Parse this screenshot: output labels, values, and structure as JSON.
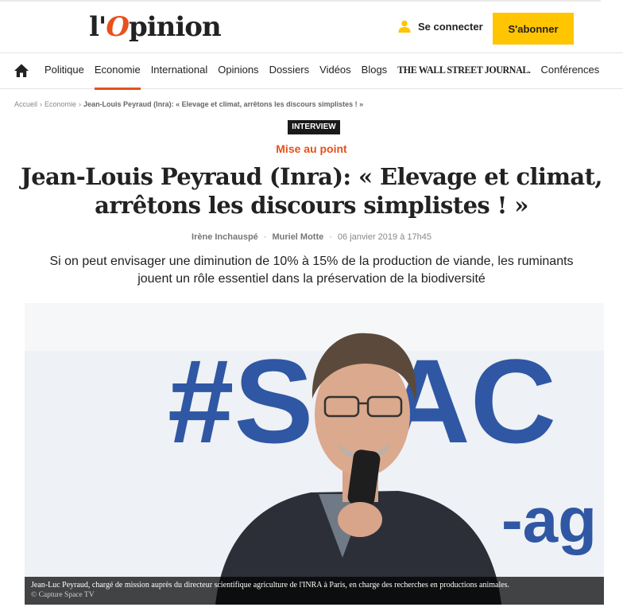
{
  "header": {
    "logo_prefix": "l'",
    "logo_o": "O",
    "logo_suffix": "pinion",
    "login_label": "Se connecter",
    "subscribe_label": "S'abonner",
    "accent_color": "#e8501c",
    "subscribe_color": "#ffc500"
  },
  "nav": {
    "home_icon": "home-icon",
    "items": [
      {
        "label": "Politique"
      },
      {
        "label": "Economie",
        "active": true
      },
      {
        "label": "International"
      },
      {
        "label": "Opinions"
      },
      {
        "label": "Dossiers"
      },
      {
        "label": "Vidéos"
      },
      {
        "label": "Blogs"
      },
      {
        "label": "THE WALL STREET JOURNAL."
      },
      {
        "label": "Conférences"
      }
    ]
  },
  "breadcrumb": {
    "items": [
      "Accueil",
      "Economie"
    ],
    "separator": "›",
    "current": "Jean-Louis Peyraud (Inra): « Elevage et climat, arrêtons les discours simplistes ! »"
  },
  "article": {
    "badge": "INTERVIEW",
    "kicker": "Mise au point",
    "title_line1": "Jean-Louis Peyraud (Inra): « Elevage et climat,",
    "title_line2": "arrêtons les discours simplistes ! »",
    "author1": "Irène Inchauspé",
    "author2": "Muriel Motte",
    "byline_dot": "·",
    "date": "06 janvier 2019 à 17h45",
    "chapo_line1": "Si on peut envisager une diminution de 10% à 15% de la production de viande, les ruminants",
    "chapo_line2": "jouent un rôle essentiel dans la préservation de la biodiversité"
  },
  "photo": {
    "banner_text": "#SPAC",
    "banner_sub": "-ag",
    "caption": "Jean-Luc Peyraud, chargé de mission auprès du directeur scientifique agriculture de l'INRA à Paris, en charge des recherches en productions animales.",
    "credit": "© Capture Space TV"
  }
}
